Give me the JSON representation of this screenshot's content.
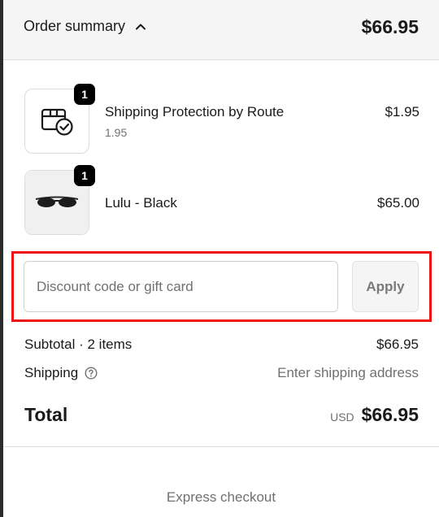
{
  "summary": {
    "toggle_label": "Order summary",
    "total": "$66.95"
  },
  "items": [
    {
      "title": "Shipping Protection by Route",
      "subtitle": "1.95",
      "price": "$1.95",
      "quantity": "1",
      "icon": "package-check-icon"
    },
    {
      "title": "Lulu - Black",
      "price": "$65.00",
      "quantity": "1",
      "icon": "sunglasses-image"
    }
  ],
  "discount": {
    "placeholder": "Discount code or gift card",
    "value": "",
    "apply_label": "Apply",
    "highlight_color": "#ee1111"
  },
  "totals": {
    "subtotal_label": "Subtotal · 2 items",
    "subtotal_value": "$66.95",
    "shipping_label": "Shipping",
    "shipping_value": "Enter shipping address",
    "total_label": "Total",
    "currency": "USD",
    "total_value": "$66.95"
  },
  "express_checkout_label": "Express checkout"
}
